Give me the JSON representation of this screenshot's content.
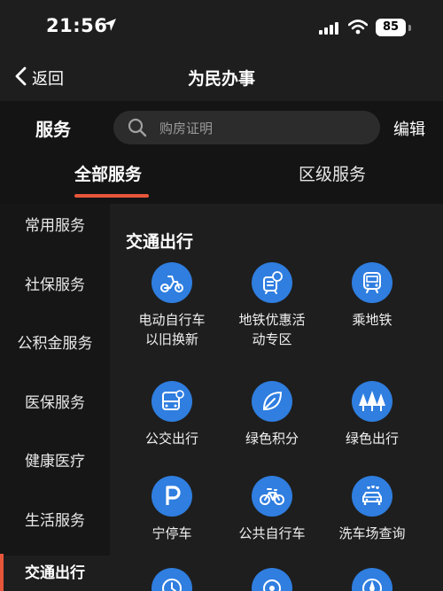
{
  "status": {
    "time": "21:56",
    "battery": "85"
  },
  "nav": {
    "back_label": "返回",
    "title": "为民办事"
  },
  "search": {
    "section_label": "服务",
    "placeholder": "购房证明",
    "edit_label": "编辑"
  },
  "tabs": {
    "all": "全部服务",
    "district": "区级服务"
  },
  "sidebar": {
    "items": [
      {
        "label": "常用服务"
      },
      {
        "label": "社保服务"
      },
      {
        "label": "公积金服务"
      },
      {
        "label": "医保服务"
      },
      {
        "label": "健康医疗"
      },
      {
        "label": "生活服务"
      },
      {
        "label": "交通出行"
      }
    ]
  },
  "content": {
    "section_title": "交通出行",
    "services": [
      {
        "line1": "电动自行车",
        "line2": "以旧换新",
        "icon": "scooter-icon"
      },
      {
        "line1": "地铁优惠活",
        "line2": "动专区",
        "icon": "metro-ticket-icon"
      },
      {
        "line1": "乘地铁",
        "line2": "",
        "icon": "metro-icon"
      },
      {
        "line1": "公交出行",
        "line2": "",
        "icon": "bus-icon"
      },
      {
        "line1": "绿色积分",
        "line2": "",
        "icon": "leaf-icon"
      },
      {
        "line1": "绿色出行",
        "line2": "",
        "icon": "trees-icon"
      },
      {
        "line1": "宁停车",
        "line2": "",
        "icon": "parking-icon"
      },
      {
        "line1": "公共自行车",
        "line2": "",
        "icon": "bicycle-icon"
      },
      {
        "line1": "洗车场查询",
        "line2": "",
        "icon": "car-wash-icon"
      }
    ]
  },
  "colors": {
    "accent": "#e8563a",
    "icon_blue": "#2f7ee0"
  }
}
